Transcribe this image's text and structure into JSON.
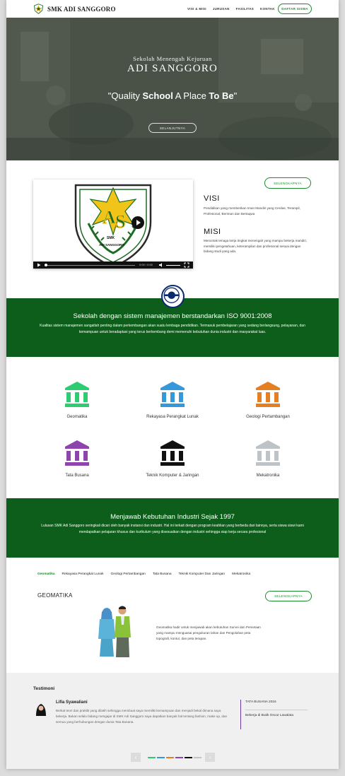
{
  "nav": {
    "brand": "SMK ADI SANGGORO",
    "menu": [
      "VISI & MISI",
      "JURUSAN",
      "FASILITAS",
      "KONTAK"
    ],
    "cta": "DAFTAR SISWA"
  },
  "hero": {
    "subtitle": "Sekolah Menengah Kejuruan",
    "title": "ADI SANGGORO",
    "quote_pre": "\"Quality ",
    "quote_b1": "School",
    "quote_mid": " A Place ",
    "quote_b2": "To Be",
    "quote_end": "\"",
    "button": "SELANJUTNYA"
  },
  "visimisi": {
    "button": "SELENGKAPNYA",
    "visi_title": "VISI",
    "visi_text": "Pendidikan yang memberikan Iman Mandiri yang Cerdas, Terampil, Profesional, Beriman dan Bertaqwa",
    "misi_title": "MISI",
    "misi_text": "Mencetak tenaga kerja tingkat menengah yang mampu bekerja mandiri, memiliki pengetahuan, keterampilan dan profesional sesuai dengan bidang studi yang ada.",
    "video_time": "0:00 / 0:00",
    "logo_text": "SMK ADI SANGGORO"
  },
  "iso": {
    "title": "Sekolah dengan sistem manajemen berstandarkan ISO 9001:2008",
    "text": "Kualitas sistem manajemen sangatlah penting dalam perkembangan akan suatu lembaga pendidikan. Termasuk pembelajaran yang sedang berlangsung, pelayanan, dan kemampuan untuk beradaptasi yang terus berkembang demi memenuhi kebutuhan dunia industri dan masyarakat luas."
  },
  "programs": [
    {
      "label": "Geomatika",
      "color": "#2ecc71"
    },
    {
      "label": "Rekayasa Perangkat Lunak",
      "color": "#3498db"
    },
    {
      "label": "Geologi Pertambangan",
      "color": "#e67e22"
    },
    {
      "label": "Tata Busana",
      "color": "#8e44ad"
    },
    {
      "label": "Teknik Komputer & Jaringan",
      "color": "#111111"
    },
    {
      "label": "Mekatronika",
      "color": "#bdc3c7"
    }
  ],
  "industry": {
    "title": "Menjawab Kebutuhan Industri Sejak 1997",
    "text": "Lulusan SMK Adi Sanggoro seringkali dicari oleh banyak instansi dan industri. Hal ini terkait dengan program keahlian yang berbeda dari lainnya, serta siswa siswi kami mendapatkan pelajaran khusus dan kurikulum yang disesuaikan dengan industri sehingga siap kerja secara profesional"
  },
  "tabs": [
    "Geomatika",
    "Rekayasa Perangkat Lunak",
    "Geologi Pertambangan",
    "Tata Busana",
    "Teknik Komputer Dan Jaringan",
    "Mekatronika"
  ],
  "geomatika": {
    "title": "GEOMATIKA",
    "button": "SELENGKAPNYA",
    "text": "Geomatika hadir untuk menjawab akan kebutuhan Survei dan Pemetaan yang mampu menguasai pengukuran lahan dan Pengolahan peta topografi, kontur, dan peta terapan."
  },
  "testimoni": {
    "title": "Testimoni",
    "name": "Lifia Syawaliani",
    "quote": "Berkat teori dan praktik yang dilatih sehingga membuat saya memiliki kemampuan dan menjadi bekal dimana saya bekerja. Bukan selalu bidang mengajar di SMK Adi Sanggoro saya dapatkan banyak hal tentang fashion, make up, dan semua yang berhubungan dengan dunia Tata Busana.",
    "program": "TATA BUSANA 2016",
    "job": "Bekerja di Butik Oscar Lawalata",
    "prev": "‹",
    "next": "›",
    "dot_colors": [
      "#2ecc71",
      "#3498db",
      "#e67e22",
      "#8e44ad",
      "#111111",
      "#bdc3c7"
    ]
  },
  "colors": {
    "accent": "#1a8a2a",
    "band": "#0d5e1a"
  }
}
